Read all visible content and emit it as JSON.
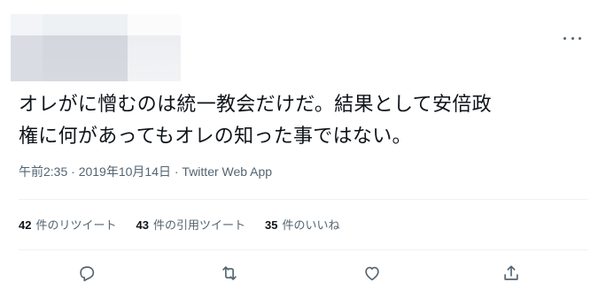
{
  "tweet": {
    "text_line1": "オレがに憎むのは統一教会だけだ。結果として安倍政",
    "text_line2": "権に何があってもオレの知った事ではない。",
    "timestamp": "午前2:35 · 2019年10月14日 · Twitter Web App"
  },
  "stats": [
    {
      "count": "42",
      "label": "件のリツイート"
    },
    {
      "count": "43",
      "label": "件の引用ツイート"
    },
    {
      "count": "35",
      "label": "件のいいね"
    }
  ],
  "actions": [
    {
      "icon": "reply-icon"
    },
    {
      "icon": "retweet-icon"
    },
    {
      "icon": "like-icon"
    },
    {
      "icon": "share-icon"
    }
  ],
  "colors": {
    "text": "#0f1419",
    "secondary": "#536471",
    "divider": "#eff3f4"
  }
}
